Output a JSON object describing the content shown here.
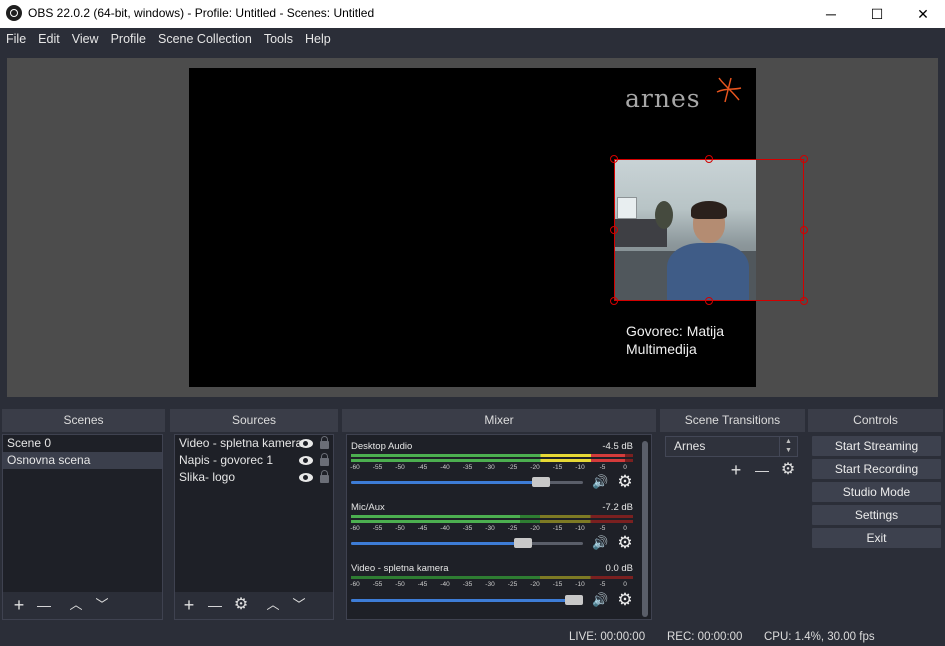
{
  "window": {
    "title": "OBS 22.0.2 (64-bit, windows) - Profile: Untitled - Scenes: Untitled",
    "minimize": "─",
    "maximize": "☐",
    "close": "✕"
  },
  "menu": [
    "File",
    "Edit",
    "View",
    "Profile",
    "Scene Collection",
    "Tools",
    "Help"
  ],
  "preview": {
    "logo_text": "arnes",
    "caption_line1": "Govorec: Matija",
    "caption_line2": "Multimedija"
  },
  "docks": {
    "scenes": "Scenes",
    "sources": "Sources",
    "mixer": "Mixer",
    "transitions": "Scene Transitions",
    "controls": "Controls"
  },
  "scenes": [
    "Scene 0",
    "Osnovna scena"
  ],
  "sources": [
    "Video - spletna kamera",
    "Napis - govorec 1",
    "Slika- logo"
  ],
  "mixer": {
    "channels": [
      {
        "name": "Desktop Audio",
        "db": "-4.5 dB",
        "level": 0.97,
        "volume": 0.82
      },
      {
        "name": "Mic/Aux",
        "db": "-7.2 dB",
        "level": 0.6,
        "volume": 0.74
      },
      {
        "name": "Video - spletna kamera",
        "db": "0.0 dB",
        "level": 0.0,
        "volume": 0.96
      }
    ],
    "ticks": [
      "-60",
      "-55",
      "-50",
      "-45",
      "-40",
      "-35",
      "-30",
      "-25",
      "-20",
      "-15",
      "-10",
      "-5",
      "0"
    ]
  },
  "transitions": {
    "selected": "Arnes"
  },
  "controls": {
    "start_streaming": "Start Streaming",
    "start_recording": "Start Recording",
    "studio_mode": "Studio Mode",
    "settings": "Settings",
    "exit": "Exit"
  },
  "status": {
    "live": "LIVE: 00:00:00",
    "rec": "REC: 00:00:00",
    "cpu": "CPU: 1.4%, 30.00 fps"
  },
  "icons": {
    "plus": "+",
    "minus": "—",
    "up": "︿",
    "down": "﹀",
    "gear": "⚙",
    "speaker": "🔊"
  }
}
